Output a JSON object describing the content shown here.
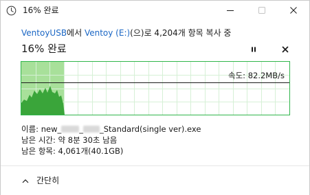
{
  "window": {
    "title": "16% 완료",
    "icons": {
      "title": "clock-icon",
      "minimize": "minimize-icon",
      "maximize": "maximize-icon",
      "close": "close-icon"
    }
  },
  "copy": {
    "source": "VentoyUSB",
    "from_text": "에서 ",
    "dest": "Ventoy (E:)",
    "rest": "(으)로 4,204개 항목 복사 중"
  },
  "progress": {
    "percent_label": "16% 완료",
    "fraction": 0.16,
    "speed_label": "속도: 82.2MB/s",
    "icons": {
      "pause": "pause-icon",
      "stop": "stop-icon"
    },
    "colors": {
      "fill": "#a8e09a",
      "wave": "#3aa53a",
      "grid": "#d6f0d6",
      "border": "#2fb54a",
      "line": "#1a1a1a"
    }
  },
  "details": {
    "name_label": "이름: ",
    "name_prefix": "new_",
    "name_sep": "_",
    "name_suffix": "_Standard(single ver).exe",
    "time_label": "남은 시간: ",
    "time_value": "약 8분 30초 남음",
    "items_label": "남은 항목: ",
    "items_value": "4,061개(40.1GB)"
  },
  "footer": {
    "collapse_label": "간단히",
    "icon": "chevron-up-icon"
  }
}
